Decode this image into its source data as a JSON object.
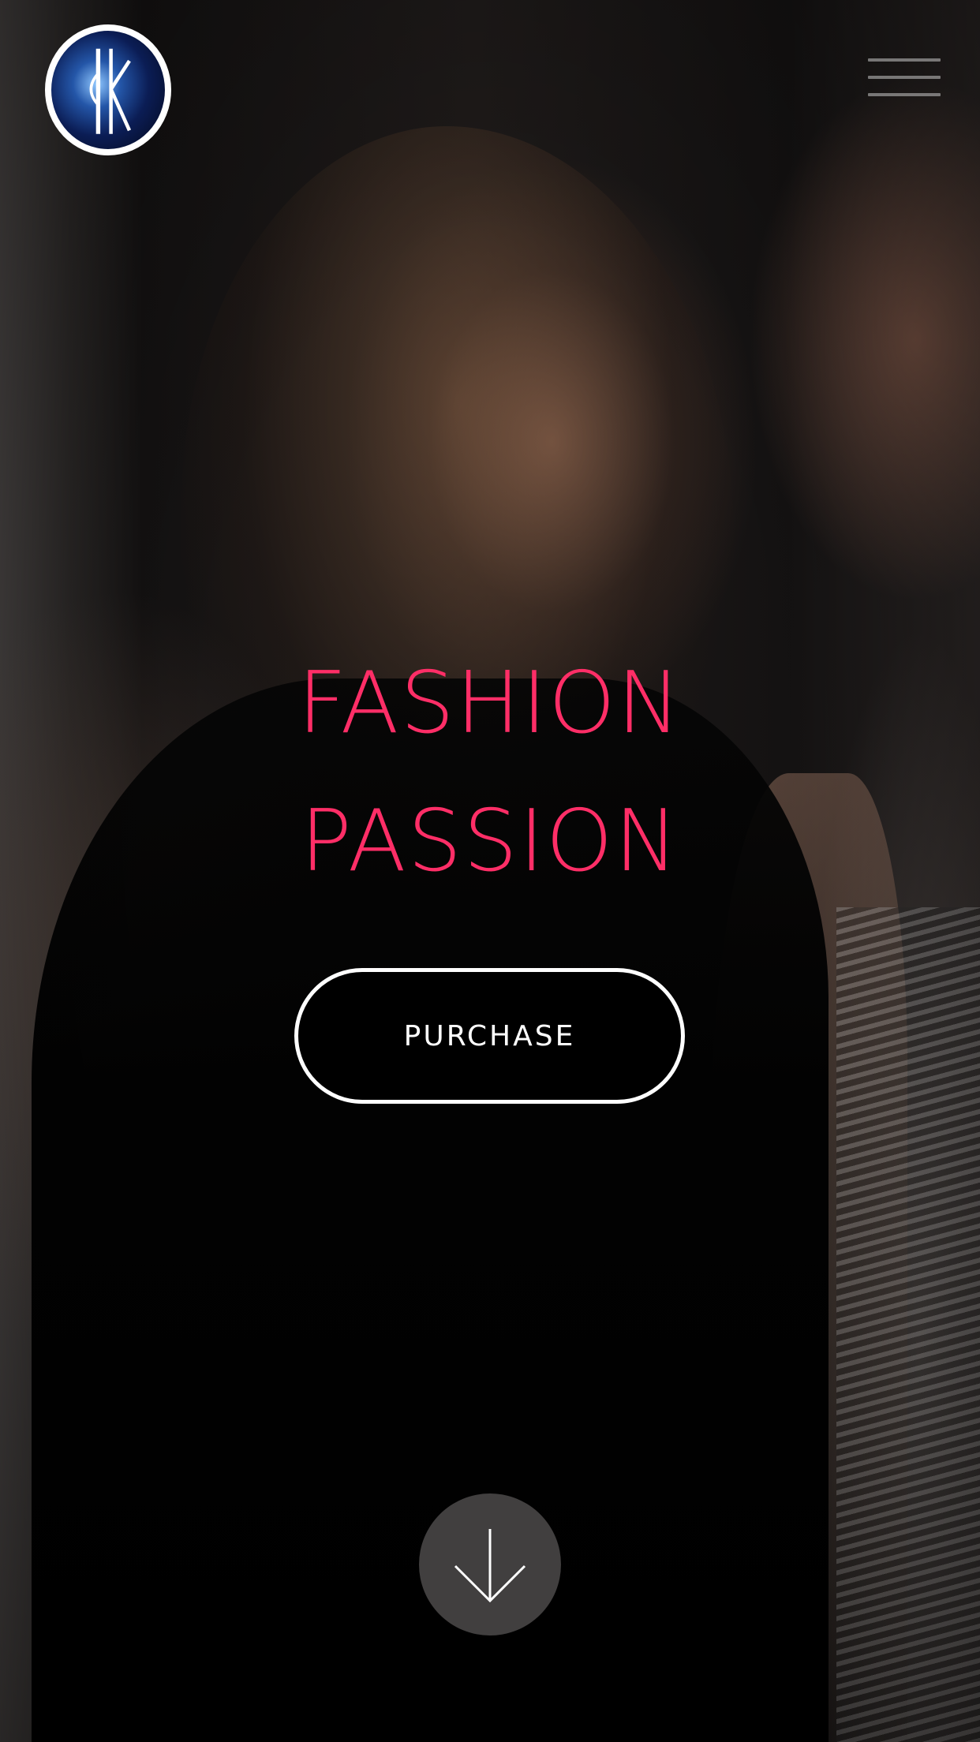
{
  "brand": {
    "logo_icon": "kk-monogram-logo-icon"
  },
  "header": {
    "menu_icon": "hamburger-menu-icon"
  },
  "hero": {
    "headline_line1": "FASHION",
    "headline_line2": "PASSION",
    "headline_color": "#ff2e67",
    "purchase_label": "PURCHASE",
    "scroll_icon": "arrow-down-icon"
  }
}
